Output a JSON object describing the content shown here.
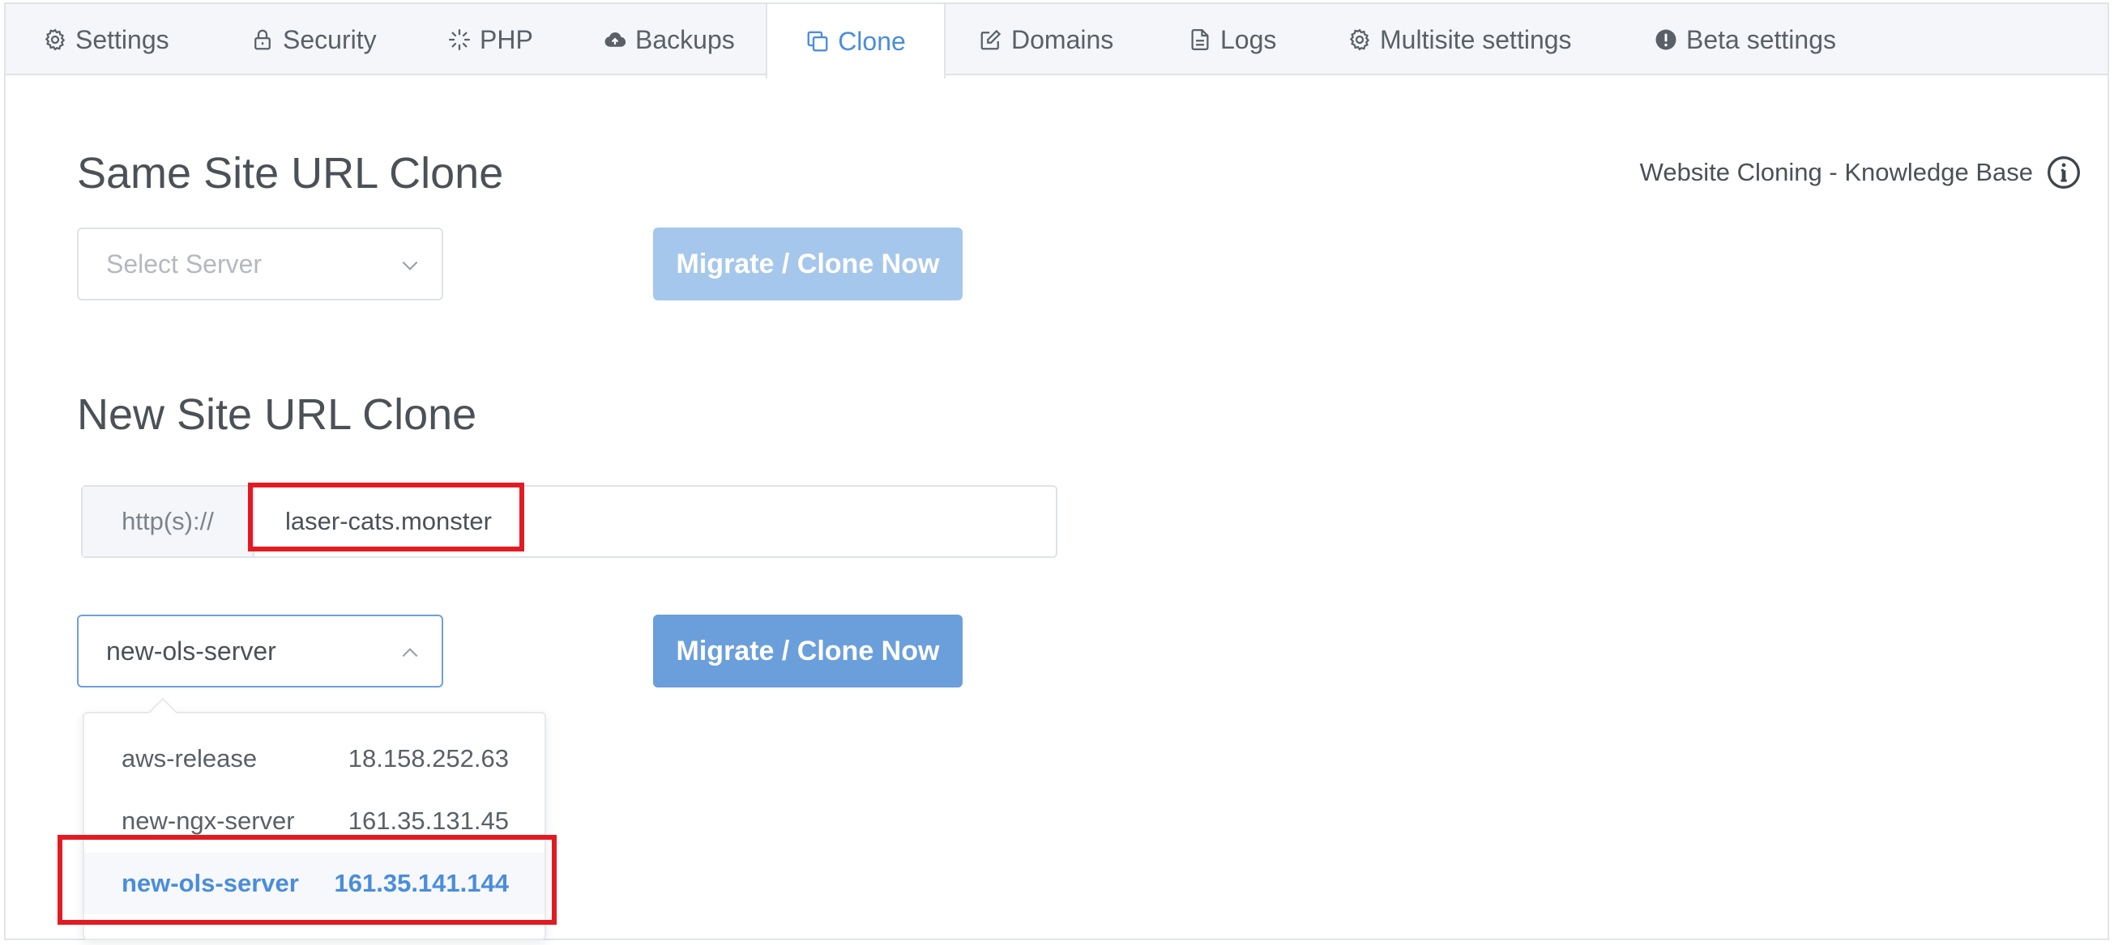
{
  "tabs": [
    {
      "label": "Settings",
      "icon": "gear-icon"
    },
    {
      "label": "Security",
      "icon": "lock-icon"
    },
    {
      "label": "PHP",
      "icon": "loader-icon"
    },
    {
      "label": "Backups",
      "icon": "cloud-upload-icon"
    },
    {
      "label": "Clone",
      "icon": "copy-icon",
      "active": true
    },
    {
      "label": "Domains",
      "icon": "edit-icon"
    },
    {
      "label": "Logs",
      "icon": "document-icon"
    },
    {
      "label": "Multisite settings",
      "icon": "gear-icon"
    },
    {
      "label": "Beta settings",
      "icon": "alert-circle-icon"
    }
  ],
  "same_site": {
    "title": "Same Site URL Clone",
    "select_placeholder": "Select Server",
    "button_label": "Migrate / Clone Now"
  },
  "knowledge_base": {
    "label": "Website Cloning - Knowledge Base",
    "icon": "info-icon"
  },
  "new_site": {
    "title": "New Site URL Clone",
    "url_prefix": "http(s)://",
    "url_value": "laser-cats.monster",
    "selected_server": "new-ols-server",
    "button_label": "Migrate / Clone Now",
    "server_options": [
      {
        "name": "aws-release",
        "ip": "18.158.252.63"
      },
      {
        "name": "new-ngx-server",
        "ip": "161.35.131.45"
      },
      {
        "name": "new-ols-server",
        "ip": "161.35.141.144",
        "selected": true
      }
    ]
  },
  "colors": {
    "accent": "#4a8ddb",
    "button_enabled": "#6b9fdb",
    "button_disabled": "#a6c7ec",
    "highlight": "#e21b23"
  }
}
